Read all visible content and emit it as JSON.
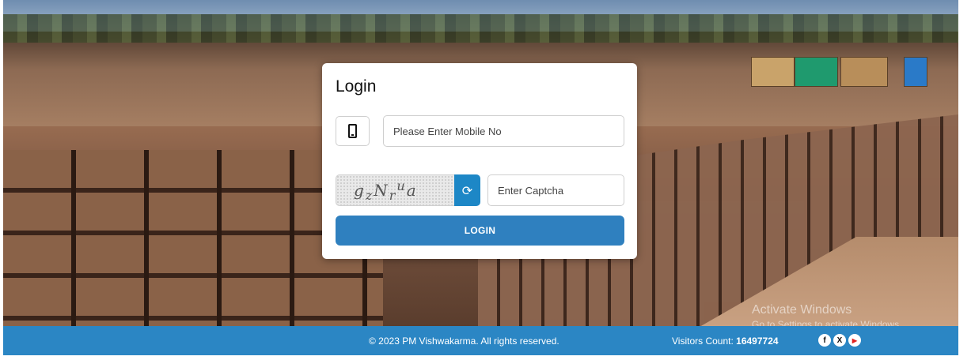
{
  "login": {
    "title": "Login",
    "mobile_placeholder": "Please Enter Mobile No",
    "captcha_text": "gzNrua",
    "captcha_placeholder": "Enter Captcha",
    "login_label": "LOGIN",
    "refresh_icon": "refresh-icon",
    "phone_icon": "mobile-phone-icon"
  },
  "footer": {
    "copyright": "© 2023 PM Vishwakarma. All rights reserved.",
    "visitors_label": "Visitors Count:",
    "visitors_count": "16497724",
    "socials": [
      "facebook-icon",
      "x-icon",
      "youtube-icon"
    ]
  },
  "watermark": {
    "line1": "Activate Windows",
    "line2": "Go to Settings to activate Windows."
  },
  "colors": {
    "primary": "#2f80bf",
    "footer": "#2b86c4",
    "refresh": "#1d87c6"
  }
}
